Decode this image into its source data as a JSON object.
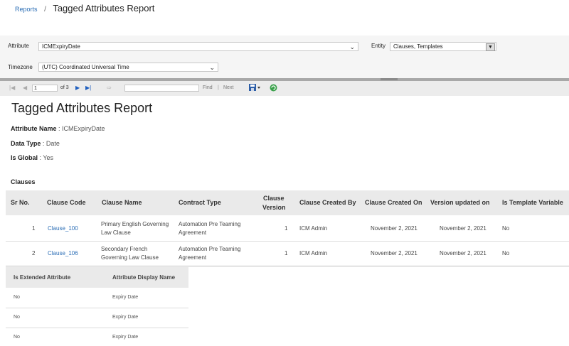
{
  "breadcrumb": {
    "link": "Reports",
    "separator": "/",
    "title": "Tagged Attributes Report"
  },
  "filters": {
    "attribute_label": "Attribute",
    "attribute_value": "ICMExpiryDate",
    "entity_label": "Entity",
    "entity_value": "Clauses, Templates",
    "timezone_label": "Timezone",
    "timezone_value": "(UTC) Coordinated Universal Time"
  },
  "toolbar": {
    "page_value": "1",
    "of_pages": "of 3",
    "find_label": "Find",
    "pipe": "|",
    "next_label": "Next"
  },
  "report": {
    "title": "Tagged Attributes Report",
    "attribute_name_label": "Attribute Name",
    "attribute_name_value": ": ICMExpiryDate",
    "data_type_label": "Data Type",
    "data_type_value": ": Date",
    "is_global_label": "Is Global",
    "is_global_value": ": Yes",
    "section": "Clauses"
  },
  "clauses_table": {
    "headers": {
      "sr_no": "Sr No.",
      "clause_code": "Clause Code",
      "clause_name": "Clause Name",
      "contract_type": "Contract Type",
      "clause_version_1": "Clause",
      "clause_version_2": "Version",
      "created_by": "Clause Created By",
      "created_on": "Clause Created On",
      "version_updated": "Version updated on",
      "template_var": "Is Template Variable"
    },
    "rows": [
      {
        "sr": "1",
        "code": "Clause_100",
        "name_1": "Primary English Governing",
        "name_2": "Law Clause",
        "type_1": "Automation Pre Teaming",
        "type_2": "Agreement",
        "version": "1",
        "created_by": "ICM Admin",
        "created_on": "November 2, 2021",
        "updated_on": "November 2, 2021",
        "template_var": "No"
      },
      {
        "sr": "2",
        "code": "Clause_106",
        "name_1": "Secondary French",
        "name_2": "Governing Law Clause",
        "type_1": "Automation Pre Teaming",
        "type_2": "Agreement",
        "version": "1",
        "created_by": "ICM Admin",
        "created_on": "November 2, 2021",
        "updated_on": "November 2, 2021",
        "template_var": "No"
      }
    ]
  },
  "extended_table": {
    "headers": {
      "extended": "Is Extended Attribute",
      "display_name": "Attribute Display Name"
    },
    "rows": [
      {
        "extended": "No",
        "display_name": "Expiry Date"
      },
      {
        "extended": "No",
        "display_name": "Expiry Date"
      },
      {
        "extended": "No",
        "display_name": "Expiry Date"
      }
    ]
  }
}
